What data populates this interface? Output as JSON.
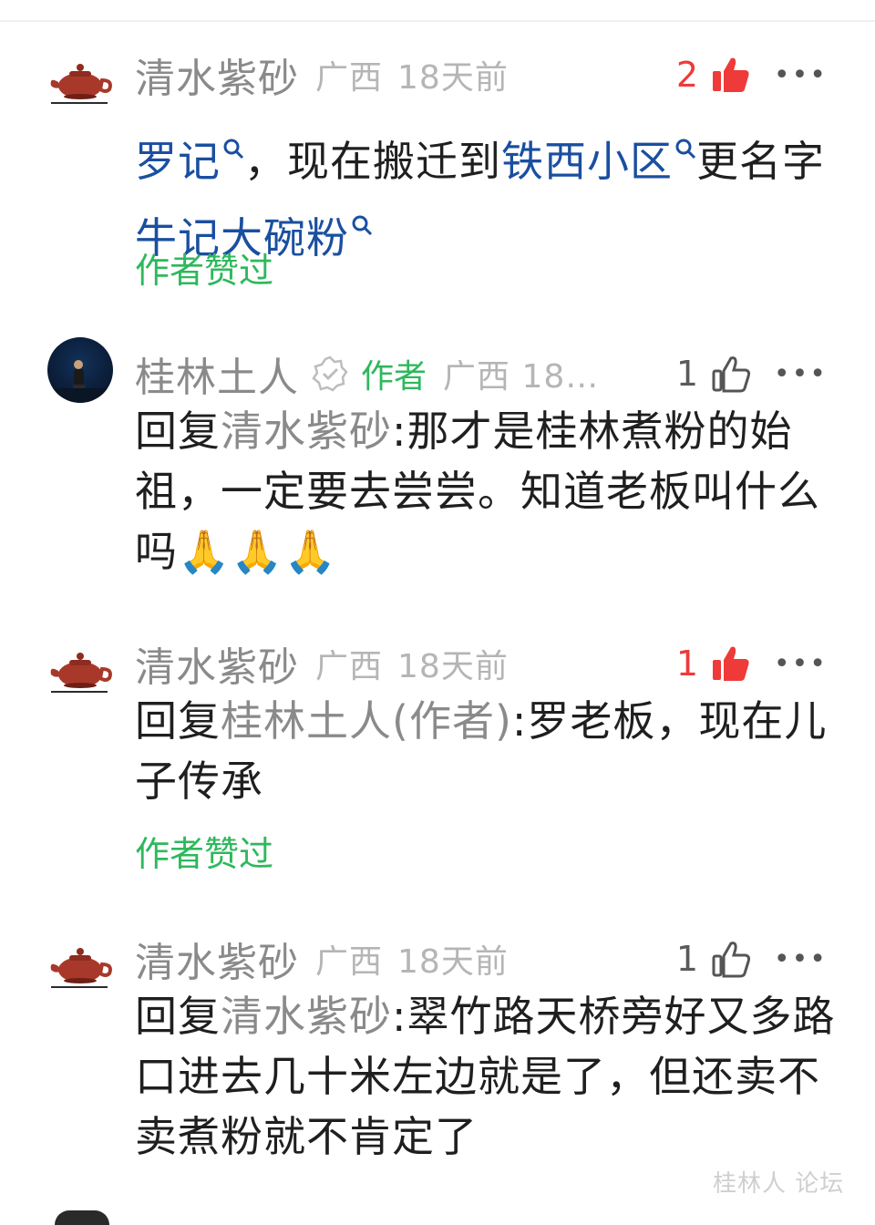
{
  "comments": [
    {
      "author": "清水紫砂",
      "location": "广西",
      "time": "18天前",
      "likes": "2",
      "body_parts": [
        {
          "text": "罗记",
          "type": "link"
        },
        {
          "text": "，现在搬迁到",
          "type": "text"
        },
        {
          "text": "铁西小区",
          "type": "link"
        },
        {
          "text": "更名字",
          "type": "text"
        },
        {
          "text": "牛记大碗粉",
          "type": "link"
        }
      ],
      "author_liked": "作者赞过"
    },
    {
      "author": "桂林土人",
      "author_tag": "作者",
      "location_time": "广西 18…",
      "likes": "1",
      "body_prefix": "回复",
      "mention": "清水紫砂",
      "body": ":那才是桂林煮粉的始祖，一定要去尝尝。知道老板叫什么吗🙏🙏🙏"
    },
    {
      "author": "清水紫砂",
      "location": "广西",
      "time": "18天前",
      "likes": "1",
      "body_prefix": "回复",
      "mention": "桂林土人(作者)",
      "body": ":罗老板，现在儿子传承",
      "author_liked": "作者赞过"
    },
    {
      "author": "清水紫砂",
      "location": "广西",
      "time": "18天前",
      "likes": "1",
      "body_prefix": "回复",
      "mention": "清水紫砂",
      "body": ":翠竹路天桥旁好又多路口进去几十米左边就是了，但还卖不卖煮粉就不肯定了"
    }
  ],
  "watermark": "桂林人 论坛",
  "colors": {
    "link": "#1a4fa0",
    "author_green": "#2eb85c",
    "like_red": "#ef3a3a",
    "name_gray": "#8a8a8a"
  },
  "icons": {
    "like_active": "thumbs-up-filled-icon",
    "like_inactive": "thumbs-up-outline-icon",
    "more": "more-dots-icon",
    "search": "search-icon",
    "verified": "verified-badge-icon"
  }
}
